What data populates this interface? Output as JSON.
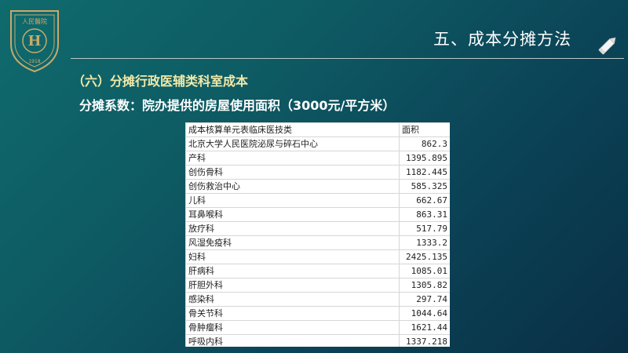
{
  "header": {
    "title": "五、成本分摊方法",
    "logo_text_top": "人民醫院",
    "logo_year": "1918",
    "logo_initial": "H"
  },
  "section": {
    "heading": "（六）分摊行政医辅类科室成本",
    "subheading": "分摊系数：院办提供的房屋使用面积（3000元/平方米）"
  },
  "table": {
    "headers": [
      "成本核算单元表临床医技类",
      "面积"
    ],
    "rows": [
      {
        "name": "北京大学人民医院泌尿与碎石中心",
        "area": "862.3"
      },
      {
        "name": "产科",
        "area": "1395.895"
      },
      {
        "name": "创伤骨科",
        "area": "1182.445"
      },
      {
        "name": "创伤救治中心",
        "area": "585.325"
      },
      {
        "name": "儿科",
        "area": "662.67"
      },
      {
        "name": "耳鼻喉科",
        "area": "863.31"
      },
      {
        "name": "放疗科",
        "area": "517.79"
      },
      {
        "name": "风湿免疫科",
        "area": "1333.2"
      },
      {
        "name": "妇科",
        "area": "2425.135"
      },
      {
        "name": "肝病科",
        "area": "1085.01"
      },
      {
        "name": "肝胆外科",
        "area": "1305.82"
      },
      {
        "name": "感染科",
        "area": "297.74"
      },
      {
        "name": "骨关节科",
        "area": "1044.64"
      },
      {
        "name": "骨肿瘤科",
        "area": "1621.44"
      },
      {
        "name": "呼吸内科",
        "area": "1337.218"
      }
    ]
  },
  "colors": {
    "background_start": "#0f6b6d",
    "background_end": "#0a2f45",
    "heading": "#f2e9a8",
    "logo": "#c9a96b"
  },
  "icons": {
    "logo": "hospital-emblem",
    "pen": "pen-icon"
  }
}
